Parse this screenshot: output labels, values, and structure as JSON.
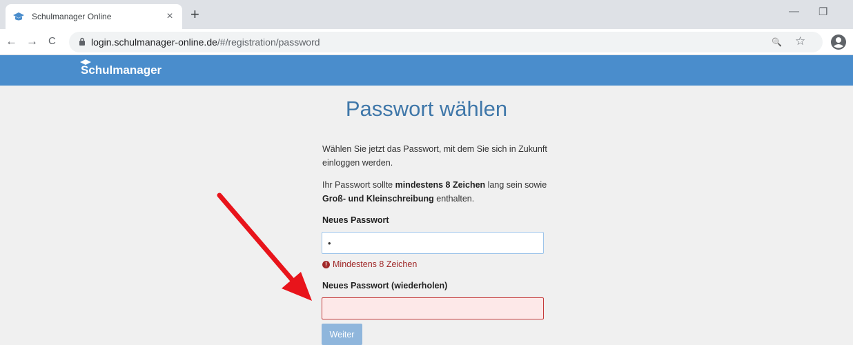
{
  "browser": {
    "tab_title": "Schulmanager Online",
    "tab_close": "×",
    "new_tab": "+",
    "minimize": "—",
    "restore": "❐",
    "back": "←",
    "forward": "→",
    "reload": "C",
    "url_host": "login.schulmanager-online.de",
    "url_path": "/#/registration/password",
    "zoom_icon": "🔍",
    "star_icon": "☆"
  },
  "app": {
    "brand": "Schulmanager"
  },
  "form": {
    "title": "Passwort wählen",
    "intro": "Wählen Sie jetzt das Passwort, mit dem Sie sich in Zukunft einloggen werden.",
    "req_prefix": "Ihr Passwort sollte ",
    "req_bold1": "mindestens 8 Zeichen",
    "req_mid": " lang sein sowie ",
    "req_bold2": "Groß- und Kleinschreibung",
    "req_suffix": " enthalten.",
    "new_label": "Neues Passwort",
    "new_value": "•",
    "error_icon": "!",
    "error_text": "Mindestens 8 Zeichen",
    "repeat_label": "Neues Passwort (wiederholen)",
    "repeat_value": "",
    "submit": "Weiter"
  },
  "colors": {
    "appbar": "#4a8dcc",
    "title": "#3f77a9",
    "error": "#a02828",
    "arrow": "#e8141b",
    "button": "#8fb6dc"
  }
}
